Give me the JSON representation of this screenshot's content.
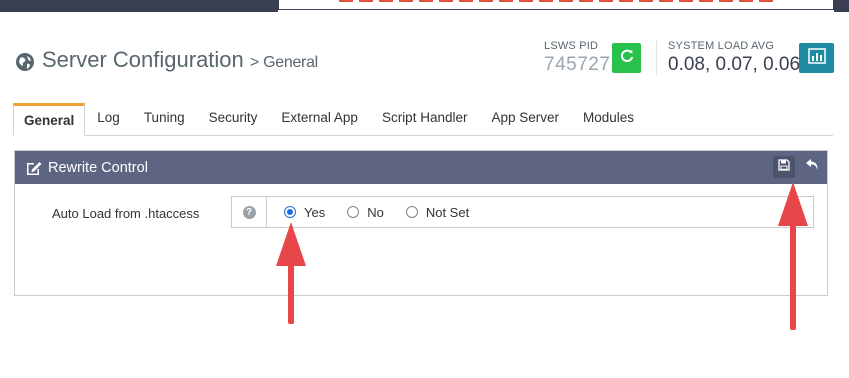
{
  "header": {
    "title": "Server Configuration",
    "crumb": "> General",
    "pid_label": "LSWS PID",
    "pid_value": "745727",
    "load_label": "SYSTEM LOAD AVG",
    "load_value": "0.08, 0.07, 0.06",
    "accent_restart": "#27c24c",
    "accent_stats": "#1f8ba3"
  },
  "tabs": [
    {
      "label": "General",
      "active": true
    },
    {
      "label": "Log"
    },
    {
      "label": "Tuning"
    },
    {
      "label": "Security"
    },
    {
      "label": "External App"
    },
    {
      "label": "Script Handler"
    },
    {
      "label": "App Server"
    },
    {
      "label": "Modules"
    }
  ],
  "panel": {
    "title": "Rewrite Control",
    "field_label": "Auto Load from .htaccess",
    "help": "?",
    "options": [
      {
        "label": "Yes",
        "checked": true
      },
      {
        "label": "No",
        "checked": false
      },
      {
        "label": "Not Set",
        "checked": false
      }
    ]
  },
  "icons": {
    "globe": "globe-icon",
    "restart": "refresh-icon",
    "stats": "bar-chart-icon",
    "edit": "edit-icon",
    "save": "save-icon",
    "undo": "undo-icon"
  },
  "annotation_color": "#e8474a"
}
